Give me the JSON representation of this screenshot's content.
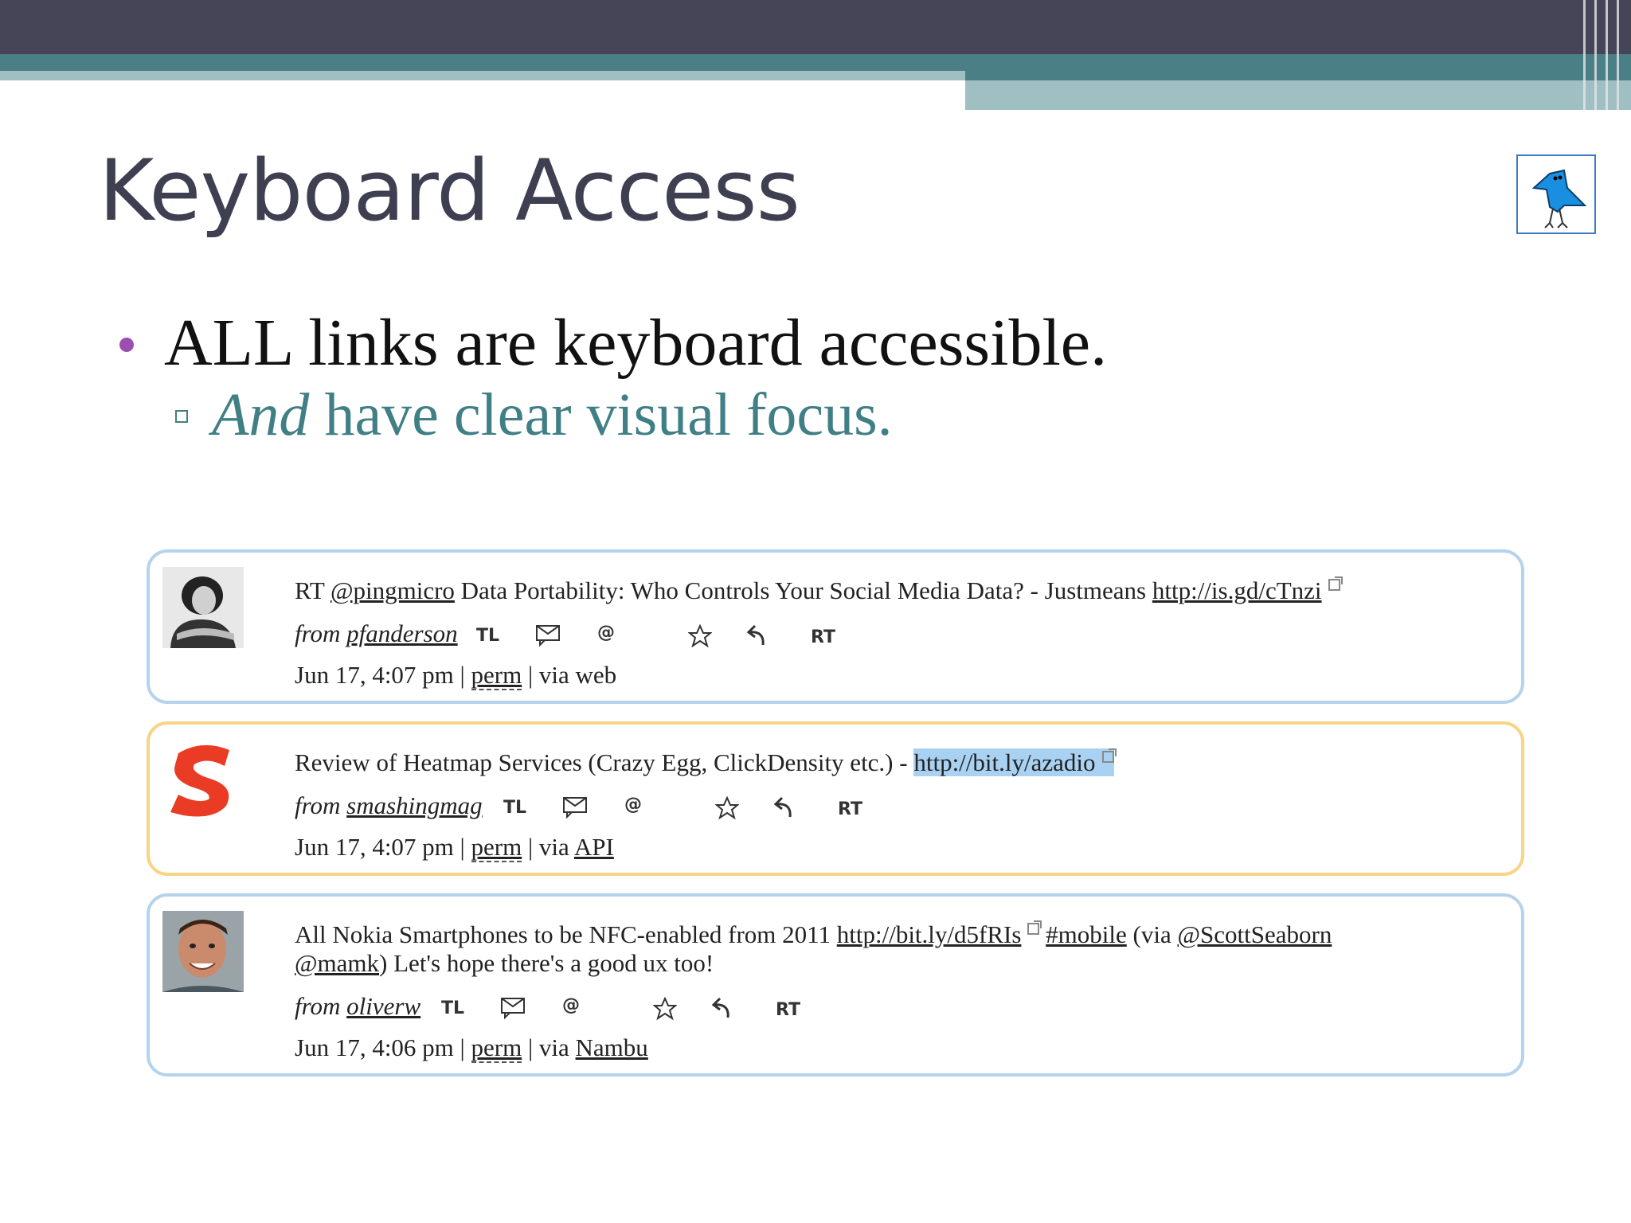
{
  "slide": {
    "title": "Keyboard Access",
    "bullet": "ALL links are keyboard accessible.",
    "sub_bullet_em": "And",
    "sub_bullet_rest": " have clear visual focus."
  },
  "colors": {
    "accent_purple": "#9b4fb0",
    "teal": "#4a7f85",
    "focus": "#f7d486",
    "border": "#b5d3ec",
    "highlight": "#a9d2f2"
  },
  "actions": {
    "tl": "TL",
    "dm": "dm-icon",
    "reply": "@",
    "fav": "star-icon",
    "reply2": "reply-arrow-icon",
    "rt": "RT"
  },
  "tweets": [
    {
      "prefix": "RT ",
      "mention": "@pingmicro",
      "text": " Data Portability: Who Controls Your Social Media Data? - Justmeans ",
      "url": "http://is.gd/cTnzi",
      "from": "from",
      "user": "pfanderson",
      "date": "Jun 17, 4:07 pm | ",
      "perm": "perm",
      "via": " | via web"
    },
    {
      "text": "Review of Heatmap Services (Crazy Egg, ClickDensity etc.) - ",
      "url": "http://bit.ly/azadio",
      "from": "from",
      "user": "smashingmag",
      "date": "Jun 17, 4:07 pm | ",
      "perm": "perm",
      "via": " | via ",
      "via_link": "API"
    },
    {
      "text": "All Nokia Smartphones to be NFC-enabled from 2011 ",
      "url": "http://bit.ly/d5fRIs",
      "hashtag": "#mobile",
      "via_paren": " (via ",
      "mention1": "@ScottSeaborn",
      "mention2": "@mamk",
      "text2": ") Let's hope there's a good ux too!",
      "from": "from",
      "user": "oliverw",
      "date": "Jun 17, 4:06 pm | ",
      "perm": "perm",
      "via": " | via ",
      "via_link": "Nambu"
    }
  ]
}
